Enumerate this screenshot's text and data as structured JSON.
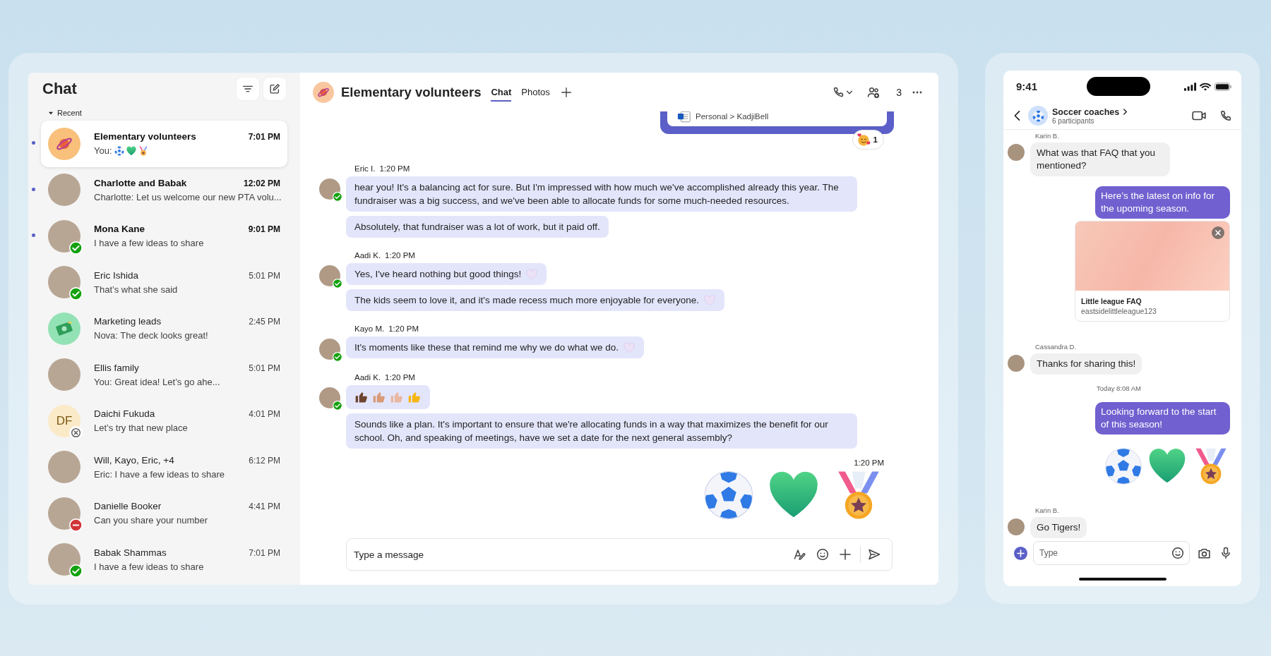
{
  "desktop": {
    "sidebar": {
      "title": "Chat",
      "section": "Recent",
      "chats": [
        {
          "name": "Elementary volunteers",
          "time": "7:01 PM",
          "preview": "You:",
          "preview_emojis": [
            {
              "kind": "soccer"
            },
            {
              "kind": "heart"
            },
            {
              "kind": "medal"
            }
          ],
          "unread": true,
          "selected": true,
          "avatar": {
            "kind": "planet"
          }
        },
        {
          "name": "Charlotte and Babak",
          "time": "12:02 PM",
          "preview": "Charlotte: Let us welcome our new PTA volu...",
          "unread": true,
          "selected": false,
          "avatar": {
            "kind": "photo"
          }
        },
        {
          "name": "Mona Kane",
          "time": "9:01 PM",
          "preview": "I have a few ideas to share",
          "unread": true,
          "selected": false,
          "avatar": {
            "kind": "photo"
          },
          "status": {
            "kind": "available"
          }
        },
        {
          "name": "Eric Ishida",
          "time": "5:01 PM",
          "preview": "That’s what she said",
          "unread": false,
          "selected": false,
          "avatar": {
            "kind": "photo"
          },
          "status": {
            "kind": "available"
          }
        },
        {
          "name": "Marketing leads",
          "time": "2:45 PM",
          "preview": "Nova: The deck looks great!",
          "unread": false,
          "selected": false,
          "avatar": {
            "kind": "money"
          }
        },
        {
          "name": "Ellis family",
          "time": "5:01 PM",
          "preview": "You: Great idea! Let’s go ahe...",
          "unread": false,
          "selected": false,
          "avatar": {
            "kind": "photo"
          }
        },
        {
          "name": "Daichi Fukuda",
          "time": "4:01 PM",
          "preview": "Let’s try that new place",
          "unread": false,
          "selected": false,
          "avatar": {
            "kind": "initials",
            "text": "DF"
          },
          "status": {
            "kind": "offline"
          }
        },
        {
          "name": "Will, Kayo, Eric, +4",
          "time": "6:12 PM",
          "preview": "Eric: I have a few ideas to share",
          "unread": false,
          "selected": false,
          "avatar": {
            "kind": "photo"
          }
        },
        {
          "name": "Danielle Booker",
          "time": "4:41 PM",
          "preview": "Can you share your number",
          "unread": false,
          "selected": false,
          "avatar": {
            "kind": "photo"
          },
          "status": {
            "kind": "busy"
          }
        },
        {
          "name": "Babak Shammas",
          "time": "7:01 PM",
          "preview": "I have a few ideas to share",
          "unread": false,
          "selected": false,
          "avatar": {
            "kind": "photo"
          },
          "status": {
            "kind": "available"
          }
        }
      ]
    },
    "chat": {
      "title": "Elementary volunteers",
      "tabs": [
        {
          "label": "Chat",
          "selected": true
        },
        {
          "label": "Photos",
          "selected": false
        }
      ],
      "participant_count": "3",
      "shared_card": {
        "path": "Personal > KadjiBell",
        "reaction_count": "1"
      },
      "groups": [
        {
          "sender": "Eric I.",
          "time": "1:20 PM",
          "status": {
            "kind": "available"
          },
          "messages": [
            {
              "kind": "text",
              "text": " hear you! It's a balancing act for sure. But I'm impressed with how much we've accomplished already this year. The fundraiser was a big success, and we've been able to allocate funds for some much-needed resources.",
              "heart": false
            },
            {
              "kind": "text",
              "text": "Absolutely, that fundraiser was a lot of work, but it paid off.",
              "heart": false
            }
          ]
        },
        {
          "sender": "Aadi K.",
          "time": "1:20 PM",
          "status": {
            "kind": "available"
          },
          "messages": [
            {
              "kind": "text",
              "text": "Yes, I've heard nothing but good things!",
              "heart": true
            },
            {
              "kind": "text",
              "text": "The kids seem to love it, and it's made recess much more enjoyable for everyone.",
              "heart": true
            }
          ]
        },
        {
          "sender": "Kayo M.",
          "time": "1:20 PM",
          "status": {
            "kind": "available"
          },
          "messages": [
            {
              "kind": "text",
              "text": "It's moments like these that remind me why we do what we do.",
              "heart": true
            }
          ]
        },
        {
          "sender": "Aadi K.",
          "time": "1:20 PM",
          "status": {
            "kind": "available"
          },
          "messages": [
            {
              "kind": "thumbs",
              "items": [
                {
                  "color": "#6e4531"
                },
                {
                  "color": "#d99a78"
                },
                {
                  "color": "#eab7a0"
                },
                {
                  "color": "#f6b614"
                }
              ]
            },
            {
              "kind": "text",
              "text": "Sounds like a plan. It's important to ensure that we're allocating funds in a way that maximizes the benefit for our school. Oh, and speaking of meetings, have we set a date for the next general assembly?",
              "heart": false
            }
          ]
        }
      ],
      "outgoing": {
        "time": "1:20 PM",
        "emojis": [
          {
            "kind": "soccer"
          },
          {
            "kind": "heart"
          },
          {
            "kind": "medal"
          }
        ]
      },
      "composer": {
        "placeholder": "Type a message"
      }
    }
  },
  "phone": {
    "status_time": "9:41",
    "chat_title": "Soccer coaches",
    "subtitle": "6 participants",
    "messages": [
      {
        "kind": "incoming",
        "sender": "Karin B.",
        "text": "What was that FAQ that you mentioned?"
      },
      {
        "kind": "outgoing",
        "text": "Here’s the latest on info for the upoming season."
      },
      {
        "kind": "link-card",
        "title": "Little league FAQ",
        "url": "eastsidelittleleague123"
      },
      {
        "kind": "incoming",
        "sender": "Cassandra D.",
        "text": "Thanks for sharing this!"
      },
      {
        "kind": "timestamp",
        "text": "Today 8:08 AM"
      },
      {
        "kind": "outgoing",
        "text": "Looking forward to the start of this season!"
      },
      {
        "kind": "emojis",
        "items": [
          {
            "kind": "soccer"
          },
          {
            "kind": "heart"
          },
          {
            "kind": "medal"
          }
        ]
      },
      {
        "kind": "incoming",
        "sender": "Karin B.",
        "text": "Go Tigers!"
      }
    ],
    "composer": {
      "placeholder": "Type"
    }
  }
}
